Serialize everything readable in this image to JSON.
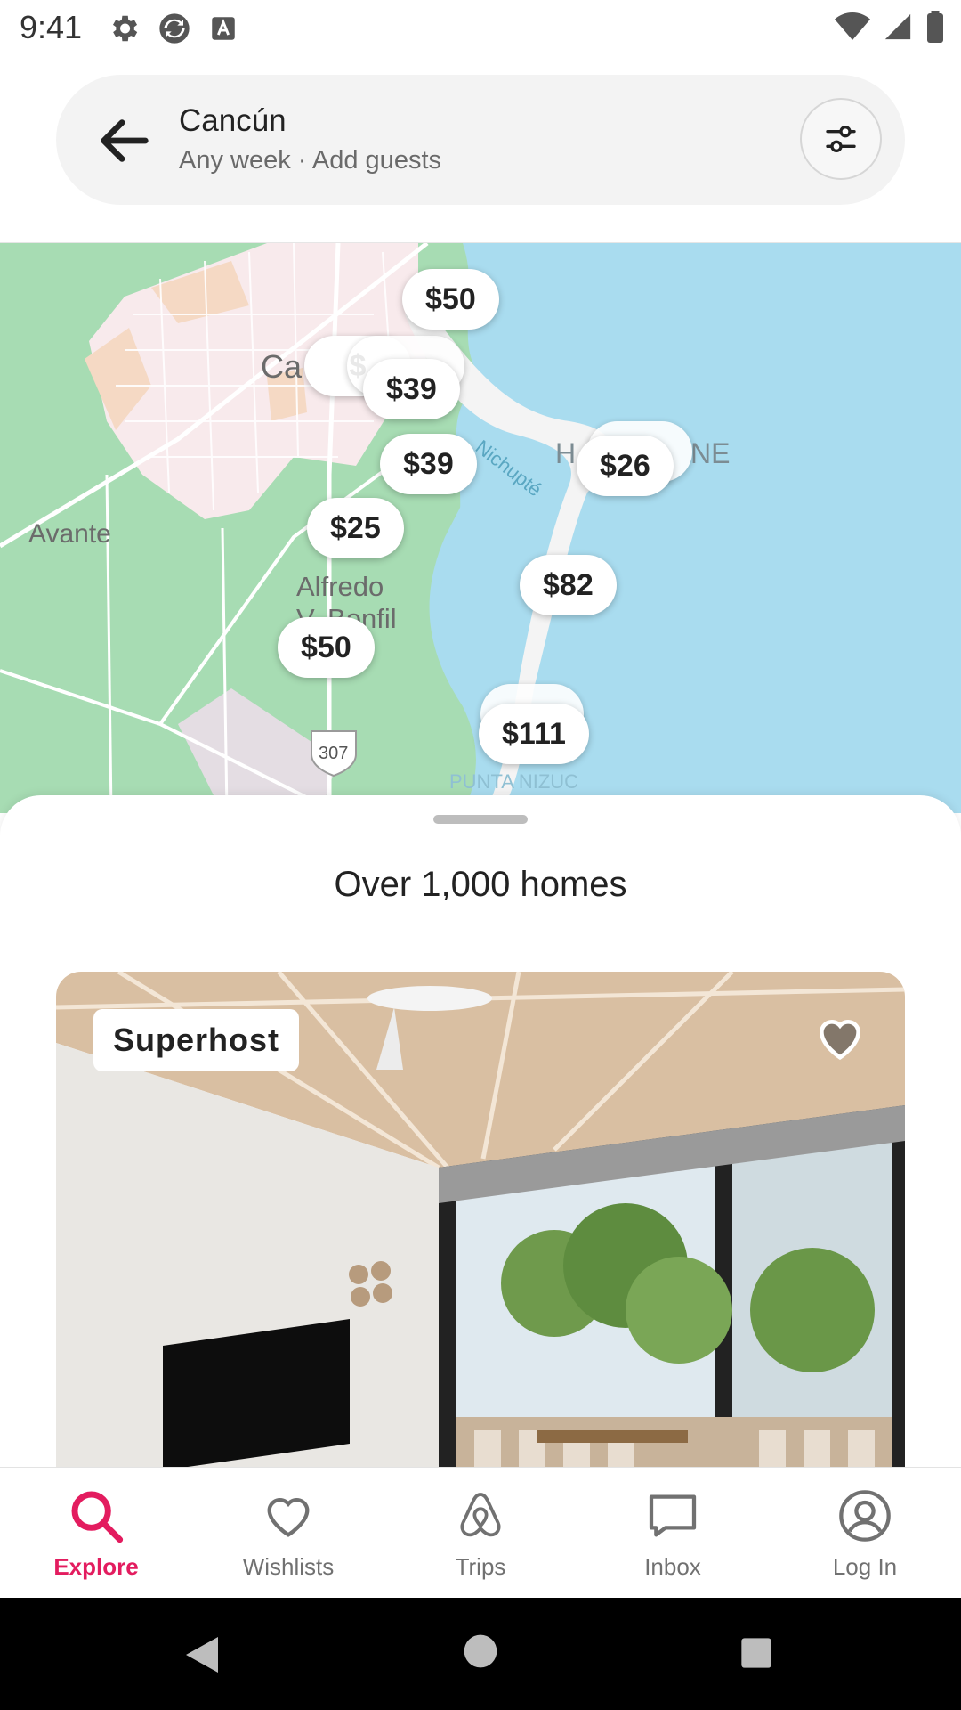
{
  "status_bar": {
    "time": "9:41"
  },
  "search": {
    "title": "Cancún",
    "subtitle": "Any week · Add guests"
  },
  "map": {
    "labels": {
      "city": "Ca",
      "avante": "Avante",
      "alfredo": "Alfredo",
      "bonfil": "V. Bonfil",
      "highway": "307",
      "punta_nizuc": "PUNTA NIZUC",
      "nichupte": "Nichupté",
      "hotel_zone_left": "H",
      "hotel_zone_right": "NE"
    },
    "pins": [
      "$50",
      "$",
      "$39",
      "$39",
      "$26",
      "$25",
      "$82",
      "$50",
      "$111"
    ]
  },
  "sheet": {
    "title": "Over 1,000 homes",
    "badge": "Superhost"
  },
  "tabs": [
    {
      "label": "Explore"
    },
    {
      "label": "Wishlists"
    },
    {
      "label": "Trips"
    },
    {
      "label": "Inbox"
    },
    {
      "label": "Log In"
    }
  ],
  "colors": {
    "accent": "#e31c5f",
    "water": "#a9dcef",
    "land": "#a7dcb3"
  }
}
